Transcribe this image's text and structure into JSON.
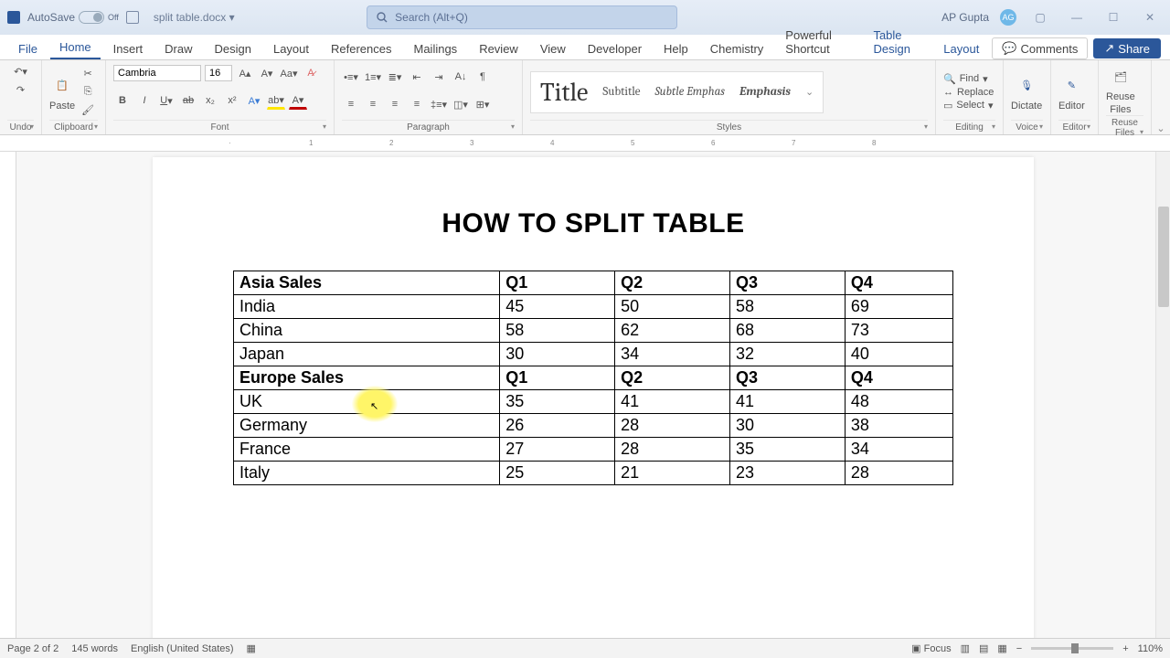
{
  "titlebar": {
    "autosave_label": "AutoSave",
    "autosave_state": "Off",
    "doc_name": "split table.docx ▾",
    "search_placeholder": "Search (Alt+Q)",
    "user_name": "AP Gupta",
    "user_initials": "AG"
  },
  "tabs": {
    "file": "File",
    "items": [
      "Home",
      "Insert",
      "Draw",
      "Design",
      "Layout",
      "References",
      "Mailings",
      "Review",
      "View",
      "Developer",
      "Help",
      "Chemistry",
      "Powerful Shortcut"
    ],
    "ctx": [
      "Table Design",
      "Layout"
    ],
    "active": "Home",
    "comments": "Comments",
    "share": "Share"
  },
  "ribbon": {
    "undo_label": "Undo",
    "clipboard_label": "Clipboard",
    "paste_label": "Paste",
    "font_label": "Font",
    "font_name": "Cambria",
    "font_size": "16",
    "para_label": "Paragraph",
    "styles_label": "Styles",
    "style_title": "Title",
    "style_subtitle": "Subtitle",
    "style_subtle": "Subtle Emphas",
    "style_emph": "Emphasis",
    "editing_label": "Editing",
    "find": "Find",
    "replace": "Replace",
    "select": "Select",
    "voice_label": "Voice",
    "dictate": "Dictate",
    "editor_label": "Editor",
    "editor": "Editor",
    "reuse_label": "Reuse Files",
    "reuse1": "Reuse",
    "reuse2": "Files"
  },
  "document": {
    "title": "HOW TO SPLIT TABLE"
  },
  "chart_data": {
    "type": "table",
    "columns": [
      "",
      "Q1",
      "Q2",
      "Q3",
      "Q4"
    ],
    "rows": [
      {
        "header": true,
        "c0": "Asia Sales",
        "c1": "Q1",
        "c2": "Q2",
        "c3": "Q3",
        "c4": "Q4"
      },
      {
        "header": false,
        "c0": "India",
        "c1": "45",
        "c2": "50",
        "c3": "58",
        "c4": "69"
      },
      {
        "header": false,
        "c0": "China",
        "c1": "58",
        "c2": "62",
        "c3": "68",
        "c4": "73"
      },
      {
        "header": false,
        "c0": "Japan",
        "c1": "30",
        "c2": "34",
        "c3": "32",
        "c4": "40"
      },
      {
        "header": true,
        "c0": "Europe Sales",
        "c1": "Q1",
        "c2": "Q2",
        "c3": "Q3",
        "c4": "Q4"
      },
      {
        "header": false,
        "c0": "UK",
        "c1": "35",
        "c2": "41",
        "c3": "41",
        "c4": "48"
      },
      {
        "header": false,
        "c0": "Germany",
        "c1": "26",
        "c2": "28",
        "c3": "30",
        "c4": "38"
      },
      {
        "header": false,
        "c0": "France",
        "c1": "27",
        "c2": "28",
        "c3": "35",
        "c4": "34"
      },
      {
        "header": false,
        "c0": "Italy",
        "c1": "25",
        "c2": "21",
        "c3": "23",
        "c4": "28"
      }
    ]
  },
  "statusbar": {
    "page": "Page 2 of 2",
    "words": "145 words",
    "lang": "English (United States)",
    "focus": "Focus",
    "zoom": "110%"
  }
}
